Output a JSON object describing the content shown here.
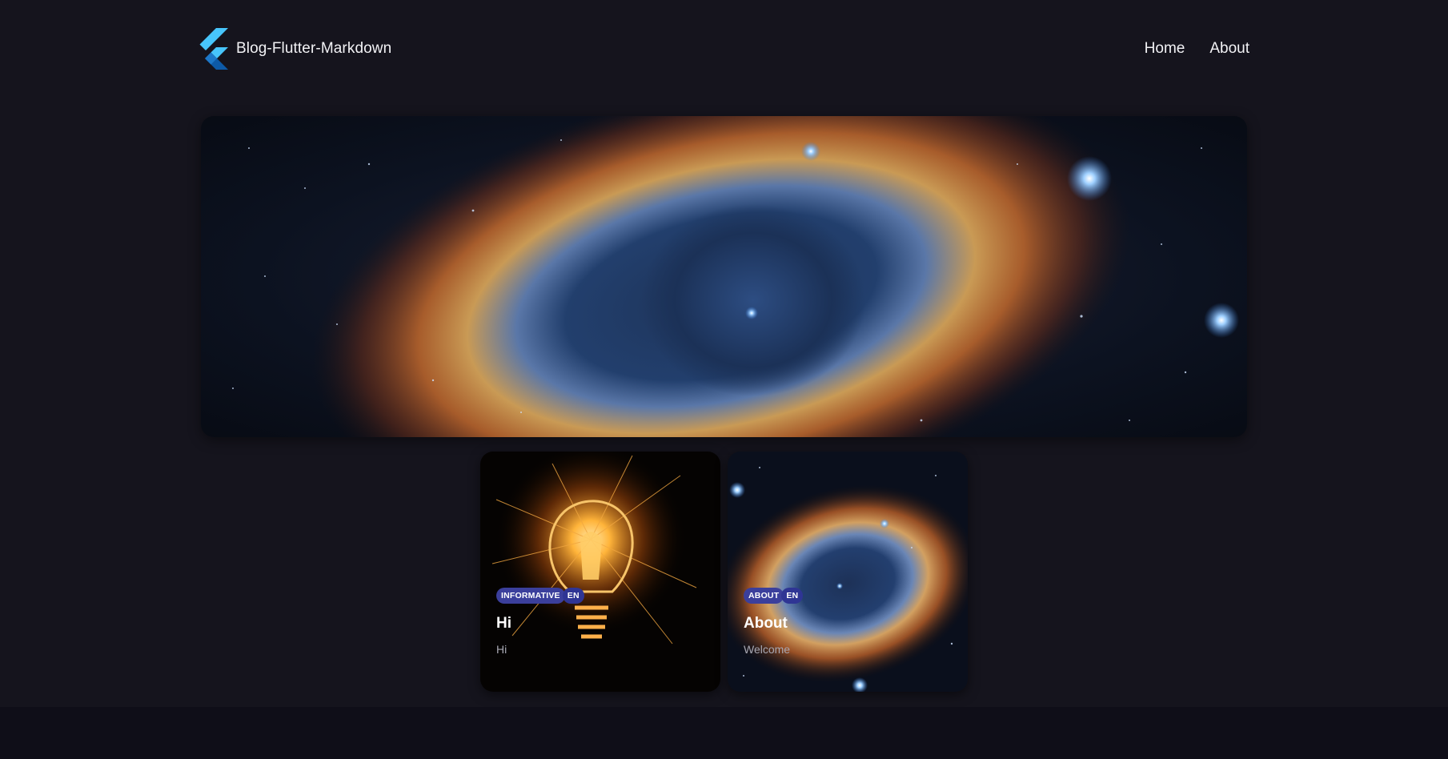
{
  "header": {
    "brand_title": "Blog-Flutter-Markdown",
    "logo_icon": "flutter-logo-icon"
  },
  "nav": {
    "items": [
      {
        "label": "Home"
      },
      {
        "label": "About"
      }
    ]
  },
  "hero": {
    "image": "helix-nebula-banner"
  },
  "cards": [
    {
      "image": "lightbulb-sparks",
      "tags": [
        "INFORMATIVE",
        "EN"
      ],
      "title": "Hi",
      "description": "Hi"
    },
    {
      "image": "helix-nebula",
      "tags": [
        "ABOUT",
        "EN"
      ],
      "title": "About",
      "description": "Welcome"
    }
  ],
  "colors": {
    "background": "#15141d",
    "footer": "#0f0e18",
    "tag": "#3b3f9c",
    "flutter_light": "#47c5fb",
    "flutter_dark": "#0d5aa7"
  }
}
